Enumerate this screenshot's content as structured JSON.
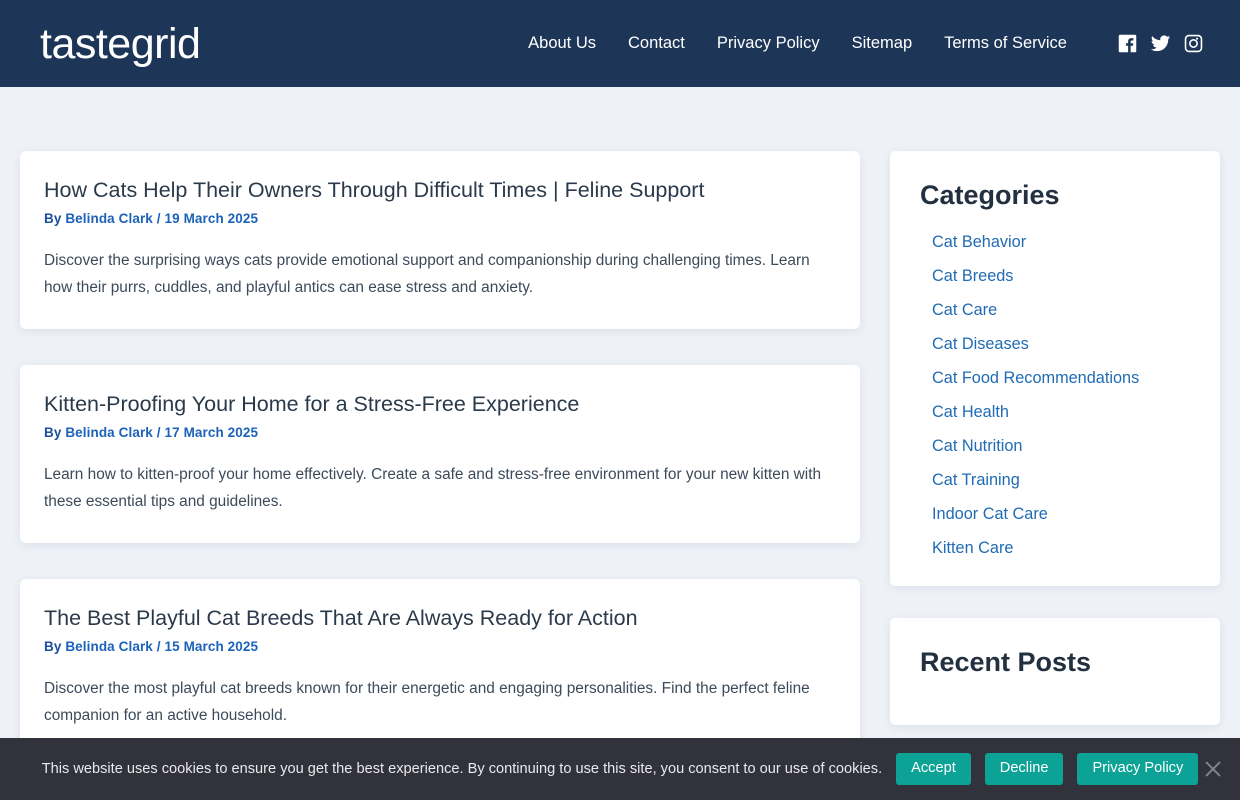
{
  "header": {
    "logo": "tastegrid",
    "nav": [
      {
        "label": "About Us"
      },
      {
        "label": "Contact"
      },
      {
        "label": "Privacy Policy"
      },
      {
        "label": "Sitemap"
      },
      {
        "label": "Terms of Service"
      }
    ],
    "social": [
      {
        "name": "facebook-icon"
      },
      {
        "name": "twitter-icon"
      },
      {
        "name": "instagram-icon"
      }
    ],
    "bg_color": "#1d3557"
  },
  "posts": [
    {
      "title": "How Cats Help Their Owners Through Difficult Times | Feline Support",
      "by_label": "By",
      "author": "Belinda Clark",
      "separator": "/",
      "date": "19 March 2025",
      "excerpt": "Discover the surprising ways cats provide emotional support and companionship during challenging times. Learn how their purrs, cuddles, and playful antics can ease stress and anxiety."
    },
    {
      "title": "Kitten-Proofing Your Home for a Stress-Free Experience",
      "by_label": "By",
      "author": "Belinda Clark",
      "separator": "/",
      "date": "17 March 2025",
      "excerpt": "Learn how to kitten-proof your home effectively. Create a safe and stress-free environment for your new kitten with these essential tips and guidelines."
    },
    {
      "title": "The Best Playful Cat Breeds That Are Always Ready for Action",
      "by_label": "By",
      "author": "Belinda Clark",
      "separator": "/",
      "date": "15 March 2025",
      "excerpt": "Discover the most playful cat breeds known for their energetic and engaging personalities. Find the perfect feline companion for an active household."
    }
  ],
  "sidebar": {
    "categories_title": "Categories",
    "categories": [
      {
        "label": "Cat Behavior"
      },
      {
        "label": "Cat Breeds"
      },
      {
        "label": "Cat Care"
      },
      {
        "label": "Cat Diseases"
      },
      {
        "label": "Cat Food Recommendations"
      },
      {
        "label": "Cat Health"
      },
      {
        "label": "Cat Nutrition"
      },
      {
        "label": "Cat Training"
      },
      {
        "label": "Indoor Cat Care"
      },
      {
        "label": "Kitten Care"
      }
    ],
    "recent_posts_title": "Recent Posts",
    "link_color": "#1f6bb5"
  },
  "cookie_banner": {
    "message": "This website uses cookies to ensure you get the best experience. By continuing to use this site, you consent to our use of cookies.",
    "accept_label": "Accept",
    "decline_label": "Decline",
    "privacy_label": "Privacy Policy",
    "close_icon": "close-icon",
    "bg_color": "#31323c",
    "button_color": "#0ca396"
  }
}
